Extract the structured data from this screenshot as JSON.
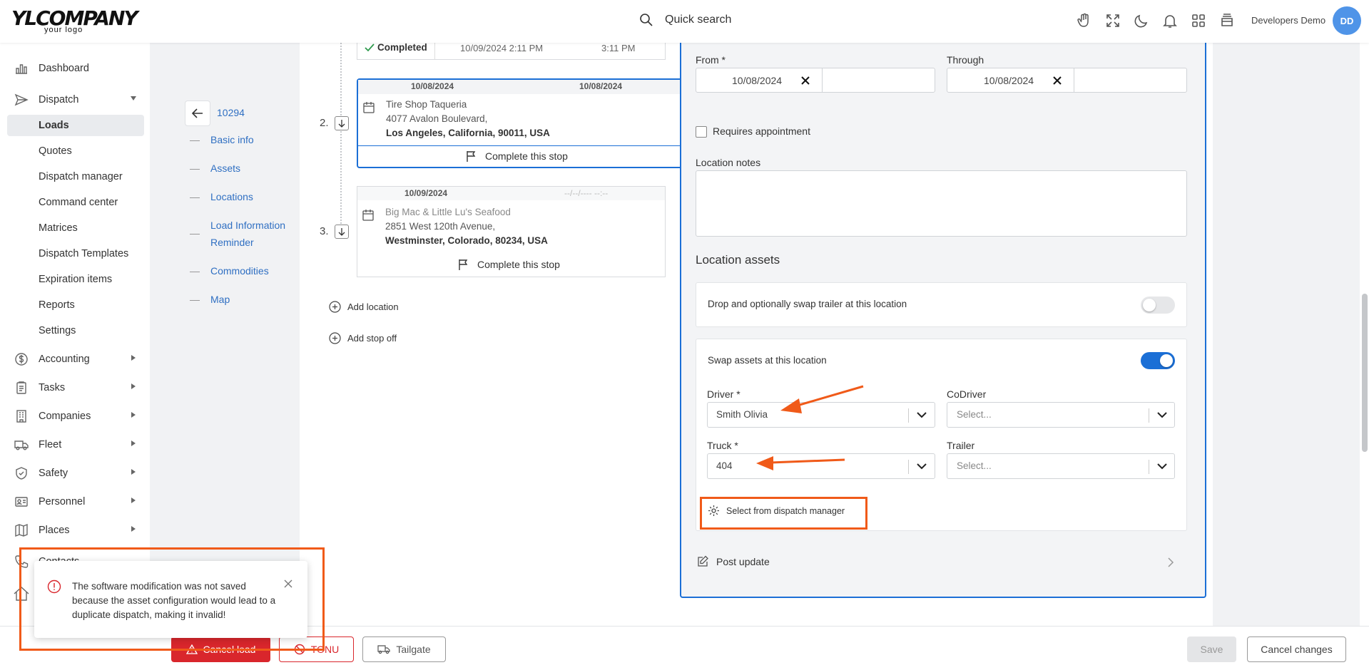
{
  "brand": {
    "logo_main": "YLCOMPANY",
    "logo_sub": "your logo"
  },
  "header": {
    "search_placeholder": "Quick search",
    "user_name": "Developers Demo",
    "user_initials": "DD",
    "icons": [
      "search-icon",
      "hand-icon",
      "fullscreen-icon",
      "moon-icon",
      "bell-icon",
      "grid-icon",
      "archive-icon"
    ]
  },
  "sidebar": {
    "items": [
      {
        "label": "Dashboard",
        "icon": "chart-icon"
      },
      {
        "label": "Dispatch",
        "icon": "send-icon"
      },
      {
        "label": "Loads"
      },
      {
        "label": "Quotes"
      },
      {
        "label": "Dispatch manager"
      },
      {
        "label": "Command center"
      },
      {
        "label": "Matrices"
      },
      {
        "label": "Dispatch Templates"
      },
      {
        "label": "Expiration items"
      },
      {
        "label": "Reports"
      },
      {
        "label": "Settings"
      },
      {
        "label": "Accounting",
        "icon": "dollar-icon"
      },
      {
        "label": "Tasks",
        "icon": "clipboard-icon"
      },
      {
        "label": "Companies",
        "icon": "building-icon"
      },
      {
        "label": "Fleet",
        "icon": "truck-icon"
      },
      {
        "label": "Safety",
        "icon": "shield-icon"
      },
      {
        "label": "Personnel",
        "icon": "id-card-icon"
      },
      {
        "label": "Places",
        "icon": "map-icon"
      },
      {
        "label": "Contacts",
        "icon": "phone-icon"
      }
    ]
  },
  "load_nav": {
    "load_number": "10294",
    "items": [
      "Basic info",
      "Assets",
      "Locations",
      "Load Information Reminder",
      "Commodities",
      "Map"
    ]
  },
  "stops": {
    "prev": {
      "status": "Completed",
      "date1": "10/09/2024 2:11 PM",
      "date2": "3:11 PM"
    },
    "stop2": {
      "index": "2.",
      "date_from": "10/08/2024",
      "date_to": "10/08/2024",
      "name": "Tire Shop Taqueria",
      "street": "4077 Avalon Boulevard,",
      "city": "Los Angeles, California, 90011, USA",
      "action": "Complete this stop"
    },
    "stop3": {
      "index": "3.",
      "date_from": "10/09/2024",
      "date_to": "--/--/---- --:--",
      "name": "Big Mac & Little Lu's Seafood",
      "street": "2851 West 120th Avenue,",
      "city": "Westminster, Colorado, 80234, USA",
      "action": "Complete this stop"
    },
    "add_location": "Add location",
    "add_stop_off": "Add stop off"
  },
  "form": {
    "from_label": "From *",
    "from_date": "10/08/2024",
    "through_label": "Through",
    "through_date": "10/08/2024",
    "requires_appointment": "Requires appointment",
    "location_notes_label": "Location notes",
    "location_assets_title": "Location assets",
    "drop_swap_label": "Drop and optionally swap trailer at this location",
    "drop_swap_on": false,
    "swap_assets_label": "Swap assets at this location",
    "swap_assets_on": true,
    "driver_label": "Driver *",
    "driver_value": "Smith Olivia",
    "codriver_label": "CoDriver",
    "codriver_placeholder": "Select...",
    "truck_label": "Truck *",
    "truck_value": "404",
    "trailer_label": "Trailer",
    "trailer_placeholder": "Select...",
    "select_dispatch_manager": "Select from dispatch manager",
    "post_update": "Post update"
  },
  "toast": {
    "message": "The software modification was not saved because the asset configuration would lead to a duplicate dispatch, making it invalid!"
  },
  "footer": {
    "cancel_load": "Cancel load",
    "tonu": "TONU",
    "tailgate": "Tailgate",
    "save": "Save",
    "cancel_changes": "Cancel changes"
  },
  "colors": {
    "accent": "#1b6fd6",
    "highlight": "#f05a19",
    "danger": "#d9262c"
  }
}
